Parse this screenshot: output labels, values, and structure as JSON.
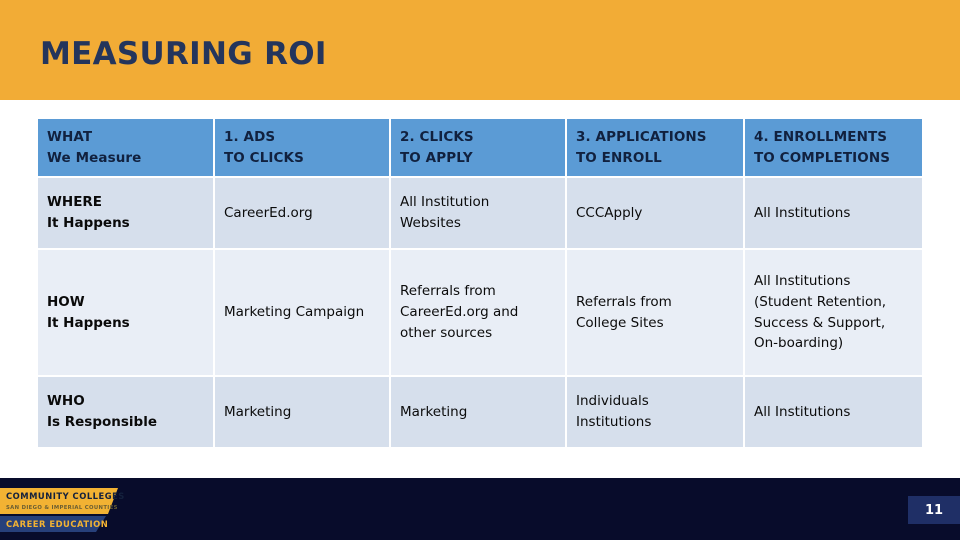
{
  "slide": {
    "title": "MEASURING ROI",
    "page_number": "11",
    "colors": {
      "header_band": "#F2AC36",
      "title_text": "#24355C",
      "table_header": "#5B9BD5",
      "row_band_dark": "#D6DFEC",
      "row_band_light": "#E9EEF6",
      "footer_band": "#080C2B",
      "page_box": "#1F2F66",
      "logo_gold": "#F2B233",
      "logo_blue": "#27407A"
    }
  },
  "table": {
    "header": [
      {
        "line1": "WHAT",
        "line2": "We Measure"
      },
      {
        "line1": "1. ADS",
        "line2": "TO CLICKS"
      },
      {
        "line1": "2. CLICKS",
        "line2": "TO APPLY"
      },
      {
        "line1": "3. APPLICATIONS",
        "line2": "TO ENROLL"
      },
      {
        "line1": "4. ENROLLMENTS",
        "line2": "TO COMPLETIONS"
      }
    ],
    "rows": [
      {
        "label_line1": "WHERE",
        "label_line2": "It Happens",
        "cells": [
          {
            "lines": [
              "CareerEd.org"
            ]
          },
          {
            "lines": [
              "All Institution",
              "Websites"
            ]
          },
          {
            "lines": [
              "CCCApply"
            ]
          },
          {
            "lines": [
              "All Institutions"
            ]
          }
        ]
      },
      {
        "label_line1": "HOW",
        "label_line2": "It Happens",
        "cells": [
          {
            "lines": [
              "Marketing Campaign"
            ]
          },
          {
            "lines": [
              "Referrals from",
              "CareerEd.org and",
              "other sources"
            ]
          },
          {
            "lines": [
              "Referrals from",
              "College Sites"
            ]
          },
          {
            "lines": [
              "All Institutions",
              "(Student Retention,",
              "Success & Support,",
              "On-boarding)"
            ]
          }
        ]
      },
      {
        "label_line1": "WHO",
        "label_line2": "Is Responsible",
        "cells": [
          {
            "lines": [
              "Marketing"
            ]
          },
          {
            "lines": [
              "Marketing"
            ]
          },
          {
            "lines": [
              "Individuals",
              "Institutions"
            ]
          },
          {
            "lines": [
              "All Institutions"
            ]
          }
        ]
      }
    ]
  },
  "logo": {
    "line1": "COMMUNITY COLLEGES",
    "line2": "SAN DIEGO & IMPERIAL COUNTIES",
    "line3": "CAREER EDUCATION"
  }
}
